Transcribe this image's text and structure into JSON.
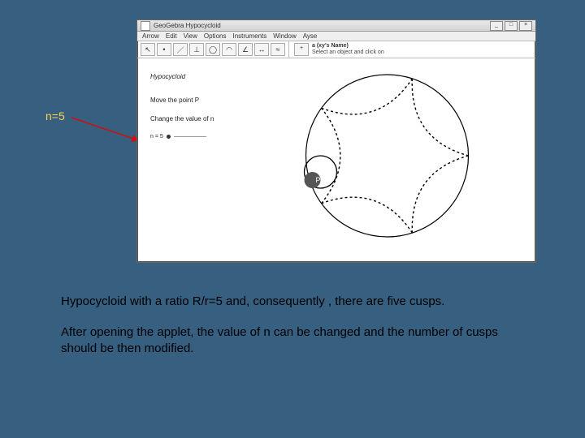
{
  "annotation": {
    "label": "n=5"
  },
  "captions": {
    "p1": "Hypocycloid with a ratio R/r=5 and, consequently , there are five cusps.",
    "p2": "After opening the applet, the value of n can be changed and the number of cusps should be then modified."
  },
  "app": {
    "title": "GeoGebra  Hypocycloid",
    "menu": [
      "Arrow",
      "Edit",
      "View",
      "Options",
      "Instruments",
      "Window",
      "Ayse"
    ],
    "toolbar_icons": [
      "cursor-icon",
      "point-icon",
      "segment-icon",
      "perpendicular-icon",
      "circle-icon",
      "ellipse-icon",
      "angle-icon",
      "transform-icon",
      "slider-icon"
    ],
    "toolbar_glyphs": [
      "↖",
      "•",
      "／",
      "⊥",
      "◯",
      "◠",
      "∠",
      "↔",
      "≈"
    ],
    "input_bar": {
      "add_label": "+",
      "cmd_label": "a (xy's Name)",
      "cmd_value": "Select an object and click on"
    },
    "text_panel": {
      "heading": "Hypocycloid",
      "line1": "Move the point P",
      "line2": "Change the value of n",
      "slider_label": "n = 5"
    },
    "window_controls": {
      "min": "_",
      "max": "□",
      "close": "×"
    }
  }
}
